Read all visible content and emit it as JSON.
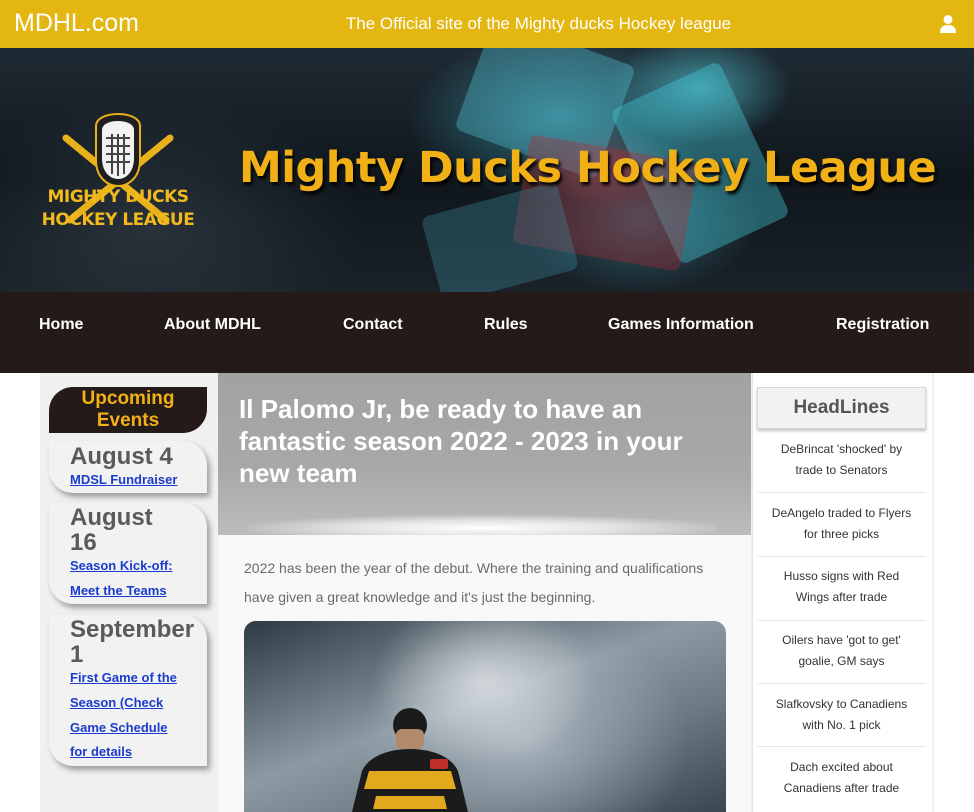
{
  "topbar": {
    "brand": "MDHL.com",
    "tagline": "The Official site of the Mighty ducks Hockey league",
    "user_icon": "user-icon"
  },
  "hero": {
    "logo_line1": "MIGHTY DUCKS",
    "logo_line2": "HOCKEY LEAGUE",
    "title": "Mighty Ducks Hockey League"
  },
  "nav": {
    "items": [
      {
        "label": "Home"
      },
      {
        "label": "About MDHL"
      },
      {
        "label": "Contact"
      },
      {
        "label": "Rules"
      },
      {
        "label": "Games Information"
      },
      {
        "label": "Registration"
      }
    ]
  },
  "events": {
    "heading_line1": "Upcoming",
    "heading_line2": "Events",
    "items": [
      {
        "date": "August 4",
        "links": [
          "MDSL Fundraiser"
        ]
      },
      {
        "date_line1": "August",
        "date_line2": "16",
        "links": [
          "Season Kick-off:",
          "Meet the Teams"
        ]
      },
      {
        "date_line1": "September",
        "date_line2": "1",
        "links": [
          "First Game of the",
          "Season (Check",
          "Game Schedule",
          "for details"
        ]
      }
    ]
  },
  "article": {
    "title": "Il Palomo Jr, be ready to have an fantastic season 2022 - 2023 in your new team",
    "text": "2022 has been the year of the debut. Where the training and qualifications have given a great knowledge and it's just the beginning."
  },
  "headlines": {
    "heading": "HeadLines",
    "items": [
      {
        "line1": "DeBrincat 'shocked' by",
        "line2": "trade to Senators"
      },
      {
        "line1": "DeAngelo traded to Flyers",
        "line2": "for three picks"
      },
      {
        "line1": "Husso signs with Red",
        "line2": "Wings after trade"
      },
      {
        "line1": "Oilers have 'got to get'",
        "line2": "goalie, GM says"
      },
      {
        "line1": "Slafkovsky to Canadiens",
        "line2": "with No. 1 pick"
      },
      {
        "line1": "Dach excited about",
        "line2": "Canadiens after trade"
      }
    ]
  },
  "colors": {
    "topbar": "#e3b611",
    "nav_bg": "#241b18",
    "accent_gold": "#f2b017",
    "link_blue": "#1a3ccc"
  }
}
